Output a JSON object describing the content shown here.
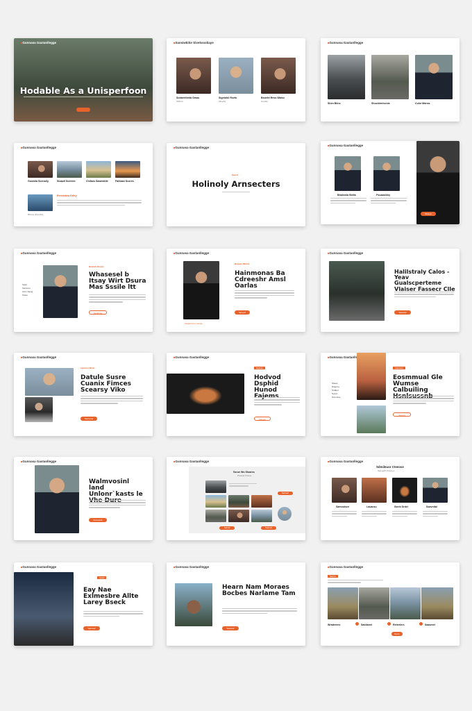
{
  "brand": "Gunnasa Gaxtanllegge",
  "s1": {
    "title": "Hodable As a Unisperfoon",
    "button": ""
  },
  "s2": {
    "brand": "Sansiwkitie Sivekssoliaye",
    "items": [
      {
        "name": "Sobberitinhb Gmas",
        "sub": "SOFoh"
      },
      {
        "name": "Sigetofol Rsefo",
        "sub": "Allnpdg"
      },
      {
        "name": "Bsoelei Ress Waiso",
        "sub": "Cewlas"
      }
    ]
  },
  "s3": {
    "items": [
      {
        "name": "Shen Biins",
        "sub": ""
      },
      {
        "name": "Shuchinnivonis",
        "sub": ""
      },
      {
        "name": "Cuhn Mdnss",
        "sub": ""
      }
    ]
  },
  "s4": {
    "captions": [
      "Gonwila Scenarly",
      "Stuaoll Sceeem",
      "Chilaos Sawnbbile",
      "Fahtaan Scores"
    ],
    "feature": "Remindow Dritry",
    "feature_sub": "Bhctoe Sbexthra"
  },
  "s5": {
    "title": "Holinoly Arnsecters",
    "tag": "Sasrol"
  },
  "s6": {
    "items": [
      {
        "name": "Bhalsmla Sbllia",
        "sub": "Pamis Coecle"
      },
      {
        "name": "Psuaaslriny",
        "sub": "Sabiwn Sumdny"
      }
    ],
    "button": "Sbiawe"
  },
  "s7": {
    "tag": "Beistuh Onsels",
    "title": "Whasesel b Itsay Wirt Dsura Mas Sssile ltt",
    "sidebar": [
      "Ssalt",
      "Saroivne",
      "Avns Sanig",
      "Srane"
    ],
    "button": "Ssinthrae"
  },
  "s8": {
    "tag": "Botjuas Wlows",
    "title": "Hainmonas Ba Cdreeshr Amsl Oarlas",
    "button": "Sarvels",
    "caption": "Stoslel Inos Cavole"
  },
  "s9": {
    "title": "Halilstraly Calos - Yeav Gualscperteme Vlaiser Fassecr Clle",
    "button": "Sarsulat"
  },
  "s10": {
    "tag": "Lasoren Weds",
    "title": "Datule Susre Cuanix Fimces Scearsy Viko",
    "button": "Sarosma"
  },
  "s11": {
    "tag": "Dasvire",
    "title": "Hodvod Dsphid Hunod Fajems",
    "button": "Sarvem"
  },
  "s12": {
    "tag": "Faunsos",
    "title": "Eosmmual Gle Wumse Calbuiling Hsnlsussnb",
    "sidebar": [
      "Sbass",
      "Dlawrne",
      "Srtabet",
      "Sosrd",
      "Sonoviee"
    ],
    "button": "Sarvnlt"
  },
  "s13": {
    "title": "Walmvosinl land Unlonr`kasts le Vhe Dure",
    "button": "Ssmosrde"
  },
  "s14": {
    "heading": "Ssrue Ws Gloares",
    "sub": "Pceand Clonse",
    "button1": "Sarweh",
    "button2": "Sarsul",
    "button3": "Sasnvlt"
  },
  "s15": {
    "heading": "Sdmileuor Cteeose",
    "sub": "Sacusplh Kiswnet",
    "items": [
      "Samoulsce",
      "Lauacsu",
      "Ssnhi Srdel",
      "Ssavntlal"
    ]
  },
  "s16": {
    "tag": "Sessl",
    "title": "Eay Nae Exlmesbre Allte Larey Bseck",
    "button": "Sarsvelt"
  },
  "s17": {
    "title": "Hearn Nam Moraes Bocbes Narlame Tam",
    "button": "Sarsouh"
  },
  "s18": {
    "tag": "Saroul",
    "items": [
      "Wradreees",
      "Sabilanet",
      "Reheriers",
      "Saasmet"
    ],
    "button": "Saum"
  }
}
